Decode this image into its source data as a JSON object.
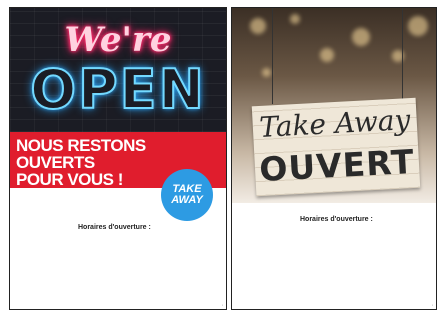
{
  "poster_open": {
    "neon_script": "We're",
    "neon_main": "OPEN",
    "headline_line1": "NOUS RESTONS OUVERTS",
    "headline_line2": "POUR VOUS !",
    "badge_line1": "TAKE",
    "badge_line2": "AWAY",
    "hours_label": "Horaires d'ouverture :",
    "colors": {
      "neon_pink": "#ff2a6b",
      "neon_blue": "#2aa8ff",
      "band_red": "#e01d2d",
      "badge_blue": "#2d9be3",
      "dark_bg": "#1b1c24"
    }
  },
  "poster_takeaway": {
    "sign_script": "Take Away",
    "sign_main": "OUVERT",
    "hours_label": "Horaires d'ouverture :",
    "colors": {
      "sign_wood": "#efe7d8",
      "text_dark": "#2a2a2a"
    }
  }
}
